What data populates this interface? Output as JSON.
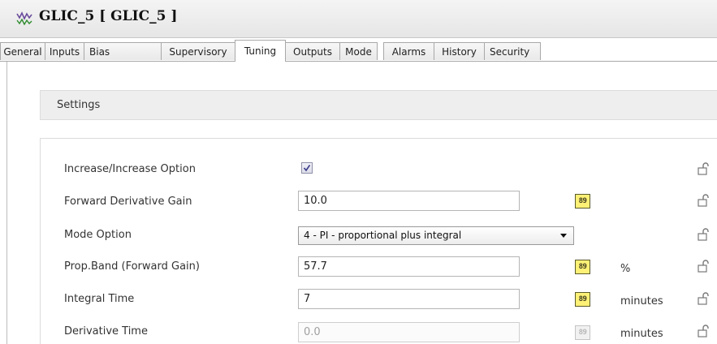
{
  "window": {
    "title": "GLIC_5 [ GLIC_5 ]",
    "icon": "waveform-icon"
  },
  "tabs": [
    {
      "label": "General",
      "active": false
    },
    {
      "label": "Inputs",
      "active": false
    },
    {
      "label": "Bias",
      "active": false
    },
    {
      "label": "Supervisory",
      "active": false
    },
    {
      "label": "Tuning",
      "active": true
    },
    {
      "label": "Outputs",
      "active": false
    },
    {
      "label": "Mode",
      "active": false
    },
    {
      "label": "Alarms",
      "active": false
    },
    {
      "label": "History",
      "active": false
    },
    {
      "label": "Security",
      "active": false
    }
  ],
  "section": {
    "title": "Settings"
  },
  "rows": [
    {
      "label": "Increase/Increase Option",
      "type": "checkbox",
      "checked": true
    },
    {
      "label": "Forward Derivative Gain",
      "type": "text",
      "value": "10.0",
      "sim_label": "89"
    },
    {
      "label": "Mode Option",
      "type": "select",
      "value": "4 - PI - proportional plus integral"
    },
    {
      "label": "Prop.Band (Forward Gain)",
      "type": "text",
      "value": "57.7",
      "sim_label": "89",
      "unit": "%"
    },
    {
      "label": "Integral Time",
      "type": "text",
      "value": "7",
      "sim_label": "89",
      "unit": "minutes"
    },
    {
      "label": "Derivative Time",
      "type": "text",
      "value": "0.0",
      "sim_label": "89",
      "unit": "minutes",
      "disabled": true
    }
  ],
  "icons": {
    "lock": "unlocked-padlock-icon",
    "sim": "lcd-digit-icon"
  },
  "colors": {
    "sim_button": "#fff176",
    "disabled_text": "#a0a0a0"
  }
}
